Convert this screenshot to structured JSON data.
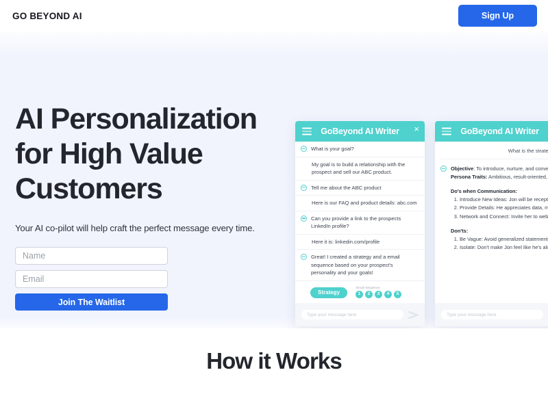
{
  "header": {
    "brand": "GO BEYOND AI",
    "signup_label": "Sign Up"
  },
  "hero": {
    "title_lines": [
      "AI Personalization",
      "for High Value",
      "Customers"
    ],
    "subtitle": "Your AI co-pilot will help craft the perfect message every time.",
    "form": {
      "name_placeholder": "Name",
      "name_value": "",
      "email_placeholder": "Email",
      "email_value": "",
      "submit_label": "Join The Waitlist"
    },
    "background_color": "#f1f4fd"
  },
  "widget_one": {
    "title": "GoBeyond AI Writer",
    "close_label": "×",
    "messages": [
      {
        "role": "bot",
        "text": "What is your goal?"
      },
      {
        "role": "user",
        "text": "My goal is to build a relationship with the prospect and sell our ABC product."
      },
      {
        "role": "bot",
        "text": "Tell me about the ABC product"
      },
      {
        "role": "user",
        "text": "Here is our FAQ and product details: abc.com"
      },
      {
        "role": "bot",
        "text": "Can you provide a link to the prospects LinkedIn profile?"
      },
      {
        "role": "user",
        "text": "Here it is: linkedin.com/profile"
      },
      {
        "role": "bot",
        "text": "Great! I created a strategy and a email sequence based on your prospect's personality and your goals!"
      }
    ],
    "strategy_chip": "Strategy",
    "sequence_label": "Email Sequence",
    "sequence_steps": [
      "1",
      "2",
      "3",
      "4",
      "5"
    ],
    "input_placeholder": "Type your message here",
    "input_value": "",
    "accent_color": "#4fd1cd"
  },
  "widget_two": {
    "title": "GoBeyond AI Writer",
    "user_question": "What is the strategy?",
    "objective_label": "Objective",
    "objective_text": ": To introduce, nurture, and convert marketers",
    "persona_label": "Persona Traits:",
    "persona_text": " Ambitious, result-oriented, loves new tactics, detail-oriented, pragmatic, extroverted in a professional setting, moderately agreeable, and slightly neurotic.",
    "dos_heading": "Do's when Communication:",
    "dos": [
      "Introduce New Ideas: Jon will be receptive to innovative strategies and tools.",
      "Provide Details: He appreciates data, metrics, and a clear breakdown of benefits.",
      "Network and Connect: Invite her to webinars, workshops, or any event where she can connect with others."
    ],
    "donts_heading": "Don'ts:",
    "donts": [
      "Be Vague: Avoid generalized statements. Olivia values specifics and details.",
      "Isolate: Don't make Jon feel like he's alone."
    ],
    "input_placeholder": "Type your message here",
    "input_value": ""
  },
  "section": {
    "how_it_works_title": "How it Works"
  }
}
